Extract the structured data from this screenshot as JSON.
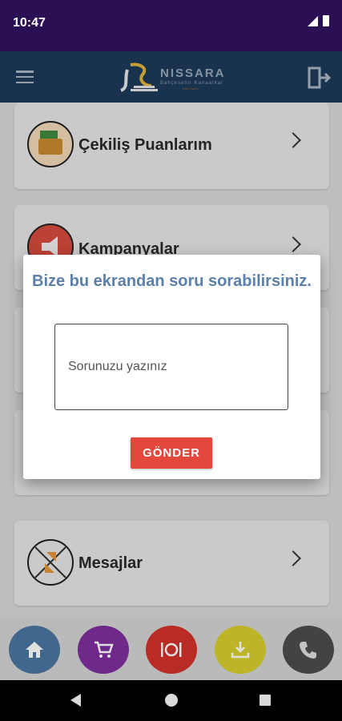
{
  "status": {
    "time": "10:47",
    "signal_icon": "signal-icon",
    "battery_icon": "battery-icon"
  },
  "app_bar": {
    "menu_icon": "hamburger-menu-icon",
    "logo_text": "NISSARA",
    "logo_subtitle": "Bahçesehir Kanaatkar",
    "logo_subtitle2": "Bahçesehir",
    "exit_icon": "exit-door-icon"
  },
  "menu": [
    {
      "label": "Çekiliş Puanlarım",
      "icon": "money-wallet-icon"
    },
    {
      "label": "Kampanyalar",
      "icon": "megaphone-icon"
    },
    {
      "label": "Mesajlar",
      "icon": "messages-arrows-icon"
    }
  ],
  "dialog": {
    "title": "Bize bu ekrandan soru sorabilirsiniz.",
    "input_placeholder": "Sorunuzu yazınız",
    "submit_label": "GÖNDER"
  },
  "bottom_nav": [
    {
      "icon": "home-icon",
      "color": "#4a76a1"
    },
    {
      "icon": "cart-icon",
      "color": "#7e2f9e"
    },
    {
      "icon": "restaurant-icon",
      "color": "#d3332c"
    },
    {
      "icon": "download-icon",
      "color": "#d8cf2d"
    },
    {
      "icon": "phone-icon",
      "color": "#4d4d4d"
    }
  ],
  "colors": {
    "status_bar": "#2a0f54",
    "app_bar": "#1d3b5a",
    "accent_button": "#e4483d",
    "dialog_title": "#5b80a9"
  }
}
